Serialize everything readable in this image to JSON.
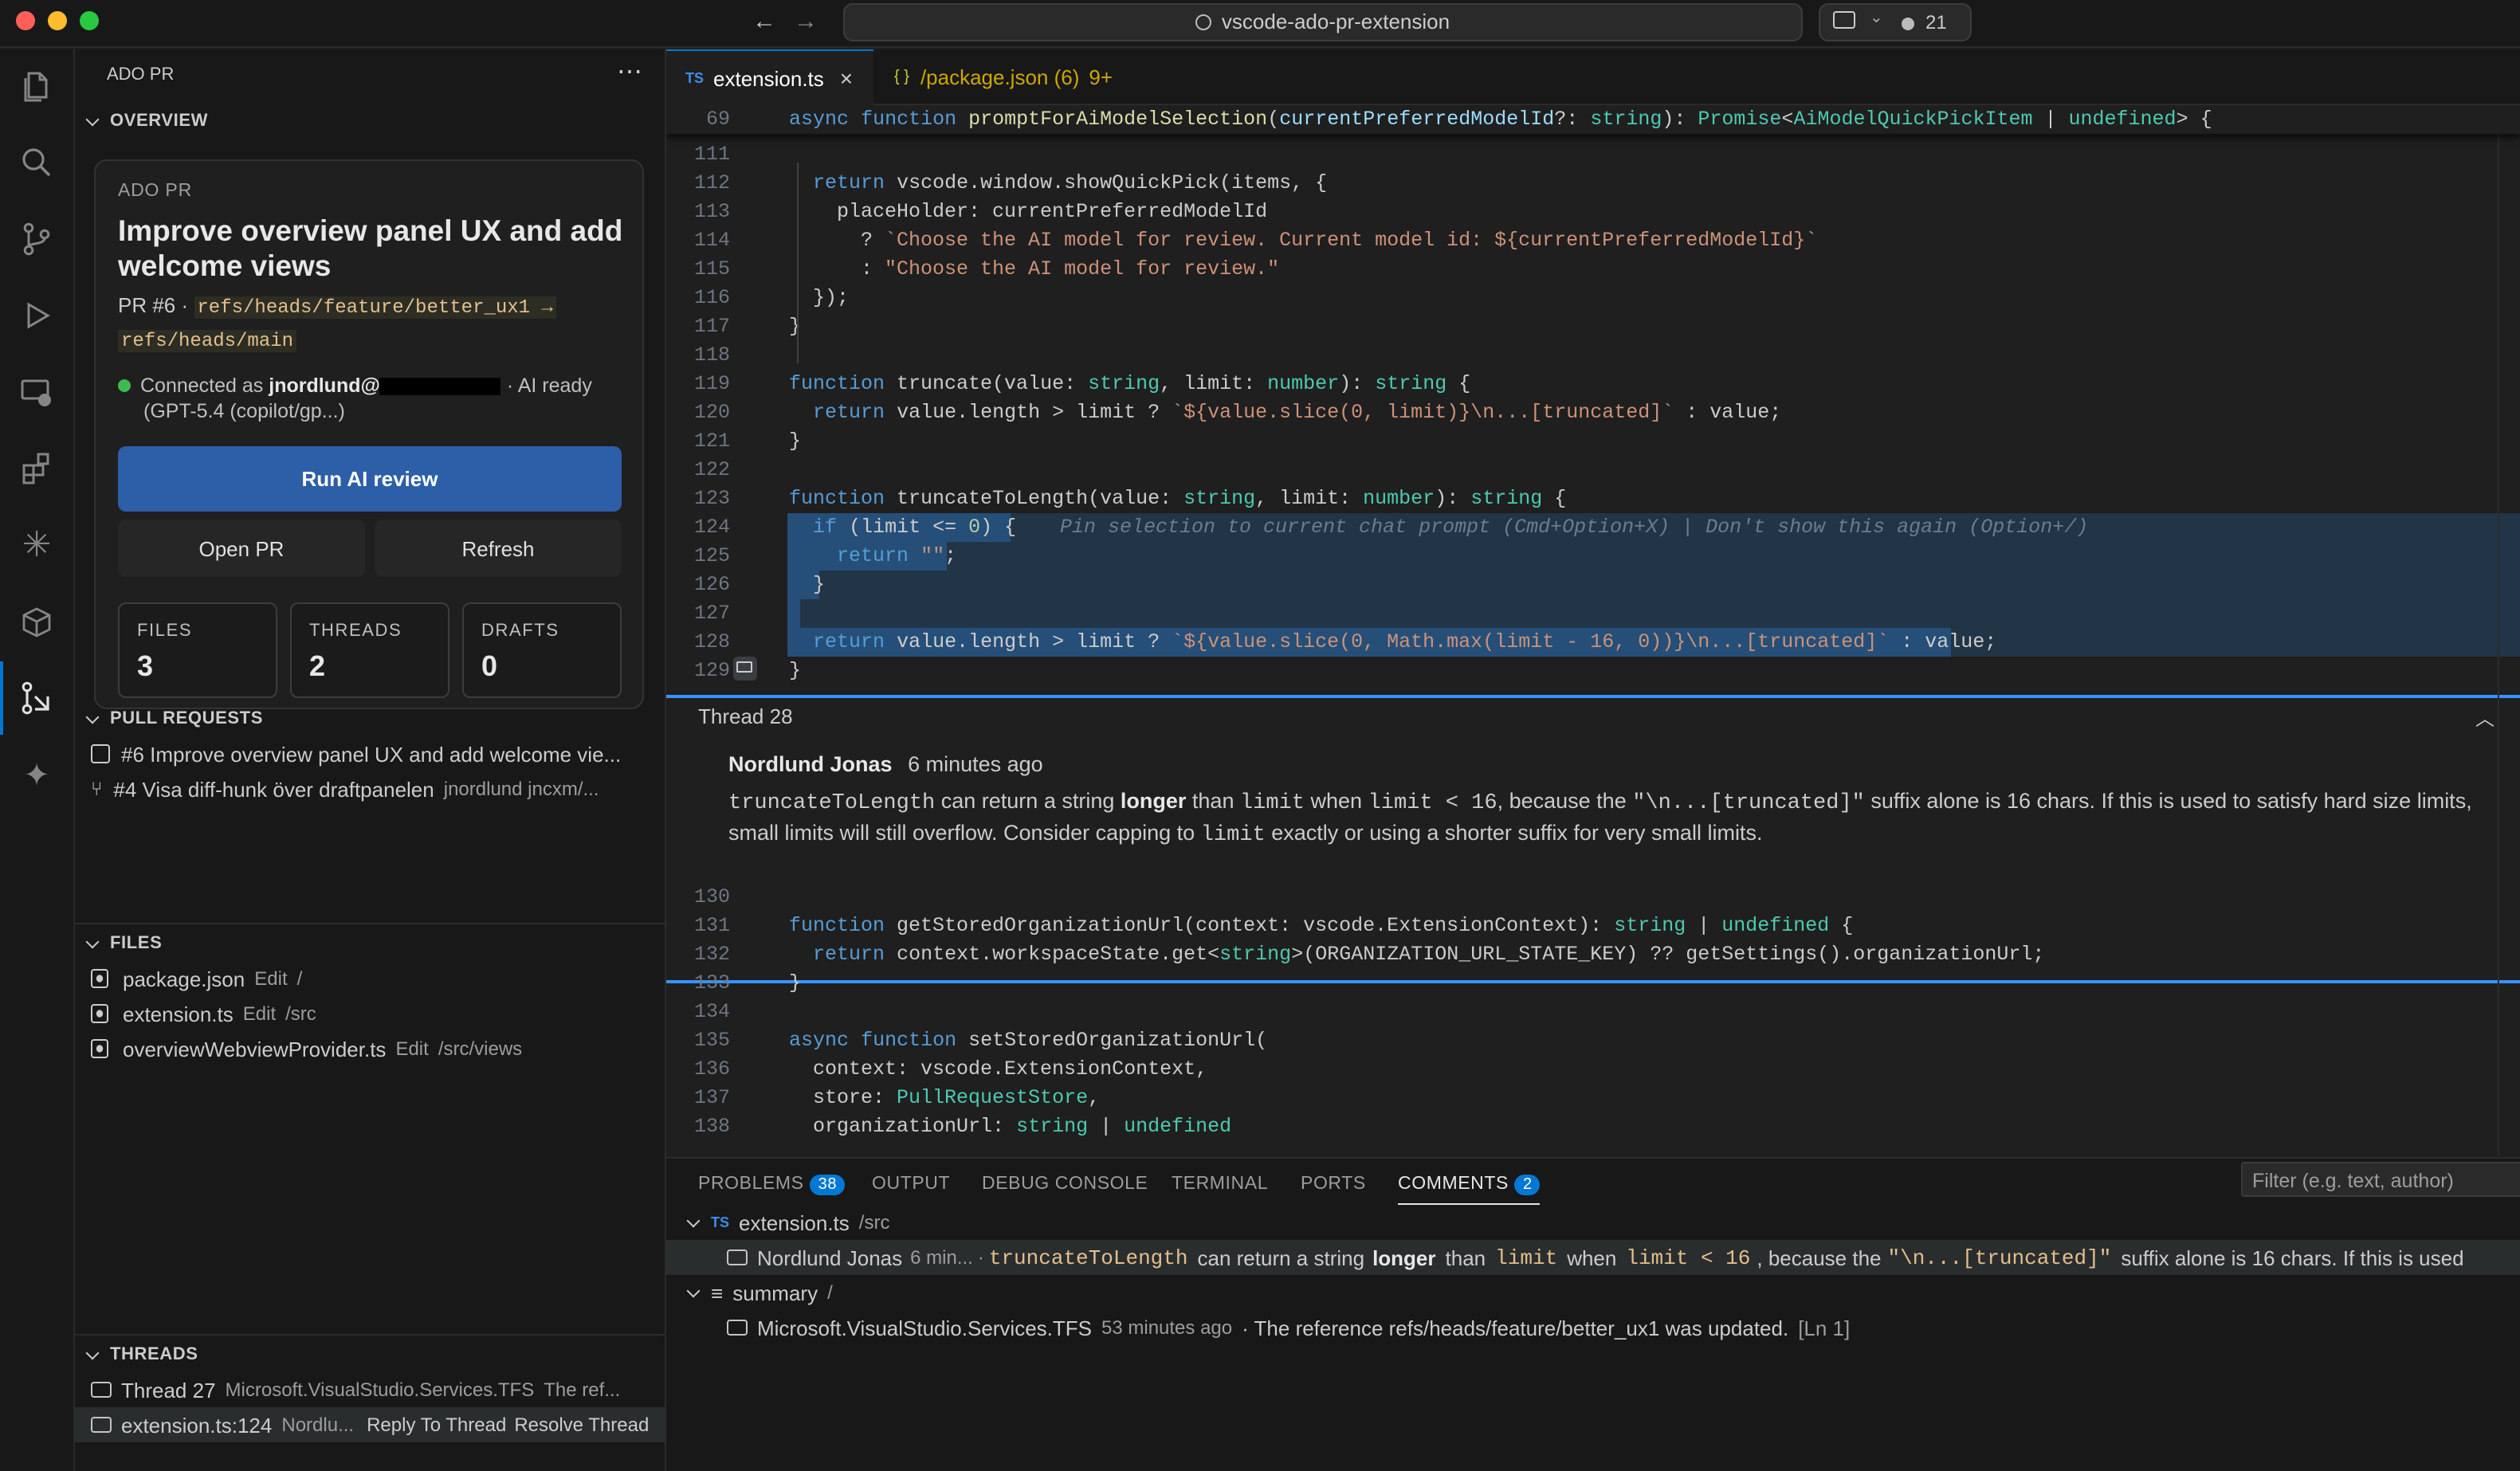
{
  "title_bar": {
    "search_text": "vscode-ado-pr-extension",
    "notifications_count": "21"
  },
  "sidebar": {
    "title": "ADO PR",
    "overview_header": "OVERVIEW",
    "card": {
      "eyebrow": "ADO PR",
      "pr_title": "Improve overview panel UX and add welcome views",
      "pr_number": "PR #6 ·",
      "source_branch": "refs/heads/feature/better_ux1 →",
      "target_branch": "refs/heads/main",
      "connected_prefix": "Connected as",
      "connected_user": "jnordlund@",
      "ai_status": "· AI ready",
      "model": "(GPT-5.4 (copilot/gp...)",
      "run_review": "Run AI review",
      "open_pr": "Open PR",
      "refresh": "Refresh",
      "stats": [
        {
          "label": "FILES",
          "value": "3"
        },
        {
          "label": "THREADS",
          "value": "2"
        },
        {
          "label": "DRAFTS",
          "value": "0"
        }
      ]
    },
    "pull_requests_header": "PULL REQUESTS",
    "pull_requests": [
      {
        "text": "#6 Improve overview panel UX and add welcome vie...",
        "meta": ""
      },
      {
        "text": "#4 Visa diff-hunk över draftpanelen",
        "meta": "jnordlund jncxm/..."
      }
    ],
    "files_header": "FILES",
    "files": [
      {
        "name": "package.json",
        "status": "Edit",
        "path": "/"
      },
      {
        "name": "extension.ts",
        "status": "Edit",
        "path": "/src"
      },
      {
        "name": "overviewWebviewProvider.ts",
        "status": "Edit",
        "path": "/src/views"
      }
    ],
    "threads_header": "THREADS",
    "threads": [
      {
        "name": "Thread 27",
        "author": "Microsoft.VisualStudio.Services.TFS",
        "snippet": "The ref..."
      },
      {
        "name": "extension.ts:124",
        "author": "Nordlu...",
        "reply": "Reply To Thread",
        "resolve": "Resolve Thread"
      }
    ]
  },
  "tabs": [
    {
      "icon": "TS",
      "label": "extension.ts",
      "active": true
    },
    {
      "icon": "{ }",
      "label": "/package.json (6)",
      "extra": "9+"
    }
  ],
  "editor": {
    "sticky": {
      "ln": "69",
      "code": "async function promptForAiModelSelection(currentPreferredModelId?: string): Promise<AiModelQuickPickItem | undefined> {"
    },
    "lines": [
      {
        "ln": "111",
        "code": ""
      },
      {
        "ln": "112",
        "code": "  return vscode.window.showQuickPick(items, {"
      },
      {
        "ln": "113",
        "code": "    placeHolder: currentPreferredModelId"
      },
      {
        "ln": "114",
        "code": "      ? `Choose the AI model for review. Current model id: ${currentPreferredModelId}`"
      },
      {
        "ln": "115",
        "code": "      : \"Choose the AI model for review.\""
      },
      {
        "ln": "116",
        "code": "  });"
      },
      {
        "ln": "117",
        "code": "}"
      },
      {
        "ln": "118",
        "code": ""
      },
      {
        "ln": "119",
        "code": "function truncate(value: string, limit: number): string {"
      },
      {
        "ln": "120",
        "code": "  return value.length > limit ? `${value.slice(0, limit)}\\n...[truncated]` : value;"
      },
      {
        "ln": "121",
        "code": "}"
      },
      {
        "ln": "122",
        "code": ""
      },
      {
        "ln": "123",
        "code": "function truncateToLength(value: string, limit: number): string {"
      },
      {
        "ln": "124",
        "code": "  if (limit <= 0) {"
      },
      {
        "ln": "125",
        "code": "    return \"\";"
      },
      {
        "ln": "126",
        "code": "  }"
      },
      {
        "ln": "127",
        "code": ""
      },
      {
        "ln": "128",
        "code": "  return value.length > limit ? `${value.slice(0, Math.max(limit - 16, 0))}\\n...[truncated]` : value;"
      },
      {
        "ln": "129",
        "code": "}"
      }
    ],
    "inline_hint": "Pin selection to current chat prompt (Cmd+Option+X) | Don't show this again (Option+/)",
    "thread": {
      "title": "Thread 28",
      "author": "Nordlund Jonas",
      "time": "6 minutes ago",
      "body_parts": [
        "truncateToLength",
        " can return a string ",
        "longer",
        " than ",
        "limit",
        " when ",
        "limit < 16",
        ", because the ",
        "\"\\n...[truncated]\"",
        " suffix alone is 16 chars. If this is used to satisfy hard size limits,"
      ],
      "body_line2": "small limits will still overflow. Consider capping to ",
      "body_code2": "limit",
      "body_line2_end": " exactly or using a shorter suffix for very small limits."
    },
    "lines_after": [
      {
        "ln": "130",
        "code": ""
      },
      {
        "ln": "131",
        "code": "function getStoredOrganizationUrl(context: vscode.ExtensionContext): string | undefined {"
      },
      {
        "ln": "132",
        "code": "  return context.workspaceState.get<string>(ORGANIZATION_URL_STATE_KEY) ?? getSettings().organizationUrl;"
      },
      {
        "ln": "133",
        "code": "}"
      },
      {
        "ln": "134",
        "code": ""
      },
      {
        "ln": "135",
        "code": "async function setStoredOrganizationUrl("
      },
      {
        "ln": "136",
        "code": "  context: vscode.ExtensionContext,"
      },
      {
        "ln": "137",
        "code": "  store: PullRequestStore,"
      },
      {
        "ln": "138",
        "code": "  organizationUrl: string | undefined"
      }
    ]
  },
  "panel": {
    "tabs": [
      {
        "label": "PROBLEMS",
        "badge": "38"
      },
      {
        "label": "OUTPUT"
      },
      {
        "label": "DEBUG CONSOLE"
      },
      {
        "label": "TERMINAL"
      },
      {
        "label": "PORTS"
      },
      {
        "label": "COMMENTS",
        "badge": "2",
        "active": true
      }
    ],
    "filter_placeholder": "Filter (e.g. text, author)",
    "groups": [
      {
        "icon": "TS",
        "file": "extension.ts",
        "path": "/src",
        "comment": {
          "author": "Nordlund Jonas",
          "time": "6 min...",
          "text_parts": [
            "truncateToLength",
            "can return a string",
            "longer",
            "than",
            "limit",
            "when",
            "limit < 16",
            ", because the",
            "\"\\n...[truncated]\"",
            "suffix alone is 16 chars. If this is used"
          ]
        }
      },
      {
        "icon": "≡",
        "file": "summary",
        "path": "/",
        "comment": {
          "author": "Microsoft.VisualStudio.Services.TFS",
          "time": "53 minutes ago",
          "text": "· The reference refs/heads/feature/better_ux1 was updated.",
          "loc": "[Ln 1]"
        }
      }
    ]
  },
  "colors": {
    "accent": "#2c5fa8",
    "link_blue": "#3794ff",
    "bg": "#1f1f1f",
    "sidebar_bg": "#181818"
  }
}
